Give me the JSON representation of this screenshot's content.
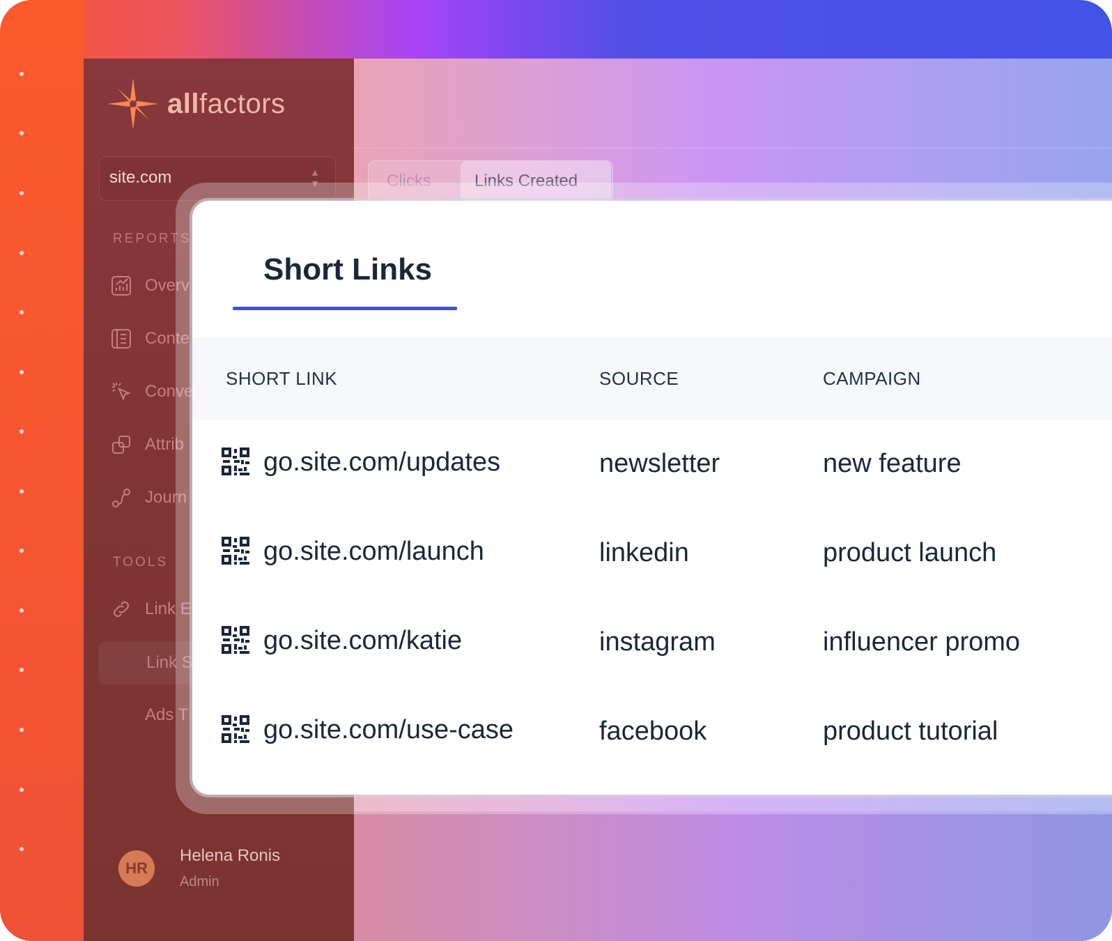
{
  "brand": {
    "name_bold": "all",
    "name_rest": "factors",
    "accent": "#f58a55"
  },
  "site_selector": {
    "value": "site.com"
  },
  "sidebar": {
    "reports_label": "REPORTS",
    "reports_items": [
      {
        "label": "Overv",
        "icon": "chart-icon"
      },
      {
        "label": "Conte",
        "icon": "document-icon"
      },
      {
        "label": "Conve",
        "icon": "cursor-click-icon"
      },
      {
        "label": "Attrib",
        "icon": "copy-icon"
      },
      {
        "label": "Journ",
        "icon": "route-icon"
      }
    ],
    "tools_label": "TOOLS",
    "tools_items": [
      {
        "label": "Link E",
        "icon": "link-icon"
      },
      {
        "label": "Link S",
        "icon": ""
      },
      {
        "label": "Ads T",
        "icon": ""
      }
    ]
  },
  "user": {
    "initials": "HR",
    "name": "Helena Ronis",
    "role": "Admin"
  },
  "tabs": [
    {
      "label": "Clicks"
    },
    {
      "label": "Links Created"
    }
  ],
  "card": {
    "title": "Short Links",
    "columns": [
      "SHORT LINK",
      "SOURCE",
      "CAMPAIGN"
    ],
    "rows": [
      {
        "short_link": "go.site.com/updates",
        "source": "newsletter",
        "campaign": "new feature"
      },
      {
        "short_link": "go.site.com/launch",
        "source": "linkedin",
        "campaign": "product launch"
      },
      {
        "short_link": "go.site.com/katie",
        "source": "instagram",
        "campaign": "influencer promo"
      },
      {
        "short_link": "go.site.com/use-case",
        "source": "facebook",
        "campaign": "product tutorial"
      }
    ]
  },
  "colors": {
    "tab_underline": "#4251d0",
    "text_dark": "#1c2638"
  }
}
